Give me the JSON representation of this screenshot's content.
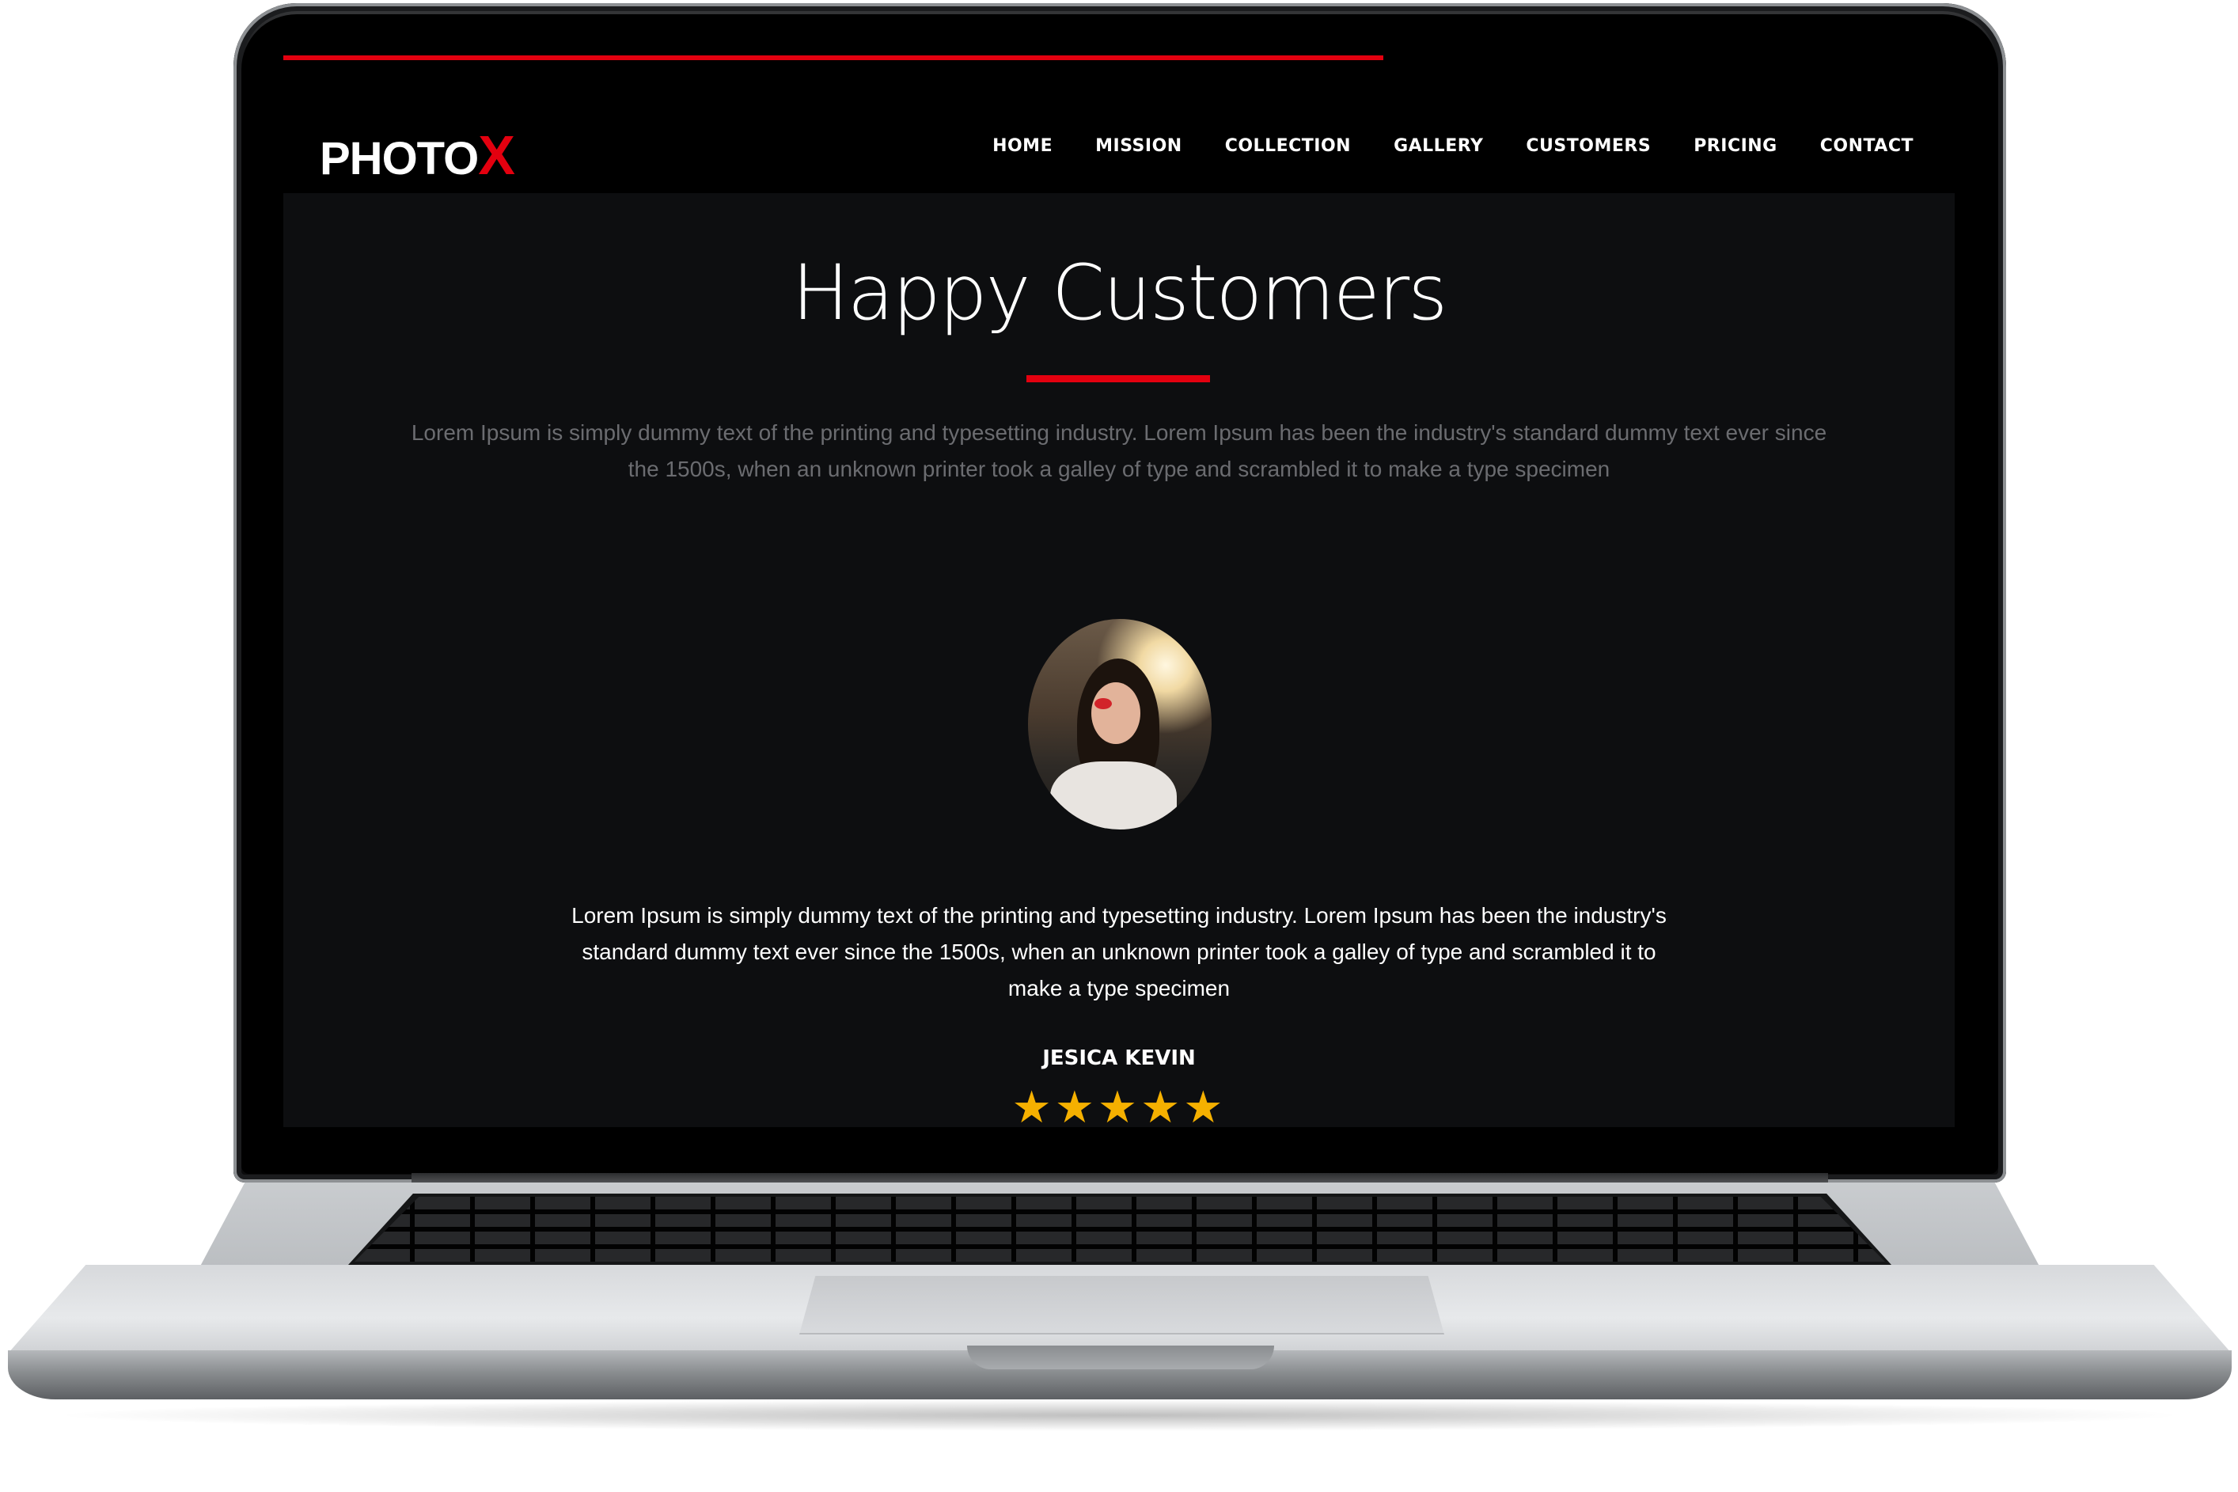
{
  "logo": {
    "text": "PHOTO",
    "accent": "X"
  },
  "nav": {
    "items": [
      "HOME",
      "MISSION",
      "COLLECTION",
      "GALLERY",
      "CUSTOMERS",
      "PRICING",
      "CONTACT"
    ]
  },
  "section": {
    "title": "Happy Customers",
    "intro": "Lorem Ipsum is simply dummy text of the printing and typesetting industry. Lorem Ipsum has been the industry's standard dummy text ever since the 1500s, when an unknown printer took a galley of type and scrambled it to make a type specimen"
  },
  "testimonial": {
    "quote": "Lorem Ipsum is simply dummy text of the printing and typesetting industry. Lorem Ipsum has been the industry's standard dummy text ever since the 1500s, when an unknown printer took a galley of type and scrambled it to make a type specimen",
    "name": "JESICA KEVIN",
    "rating": 5,
    "stars": "★★★★★",
    "avatar_icon": "customer-photo"
  },
  "carousel": {
    "slides": 3,
    "active_index": 0
  },
  "colors": {
    "accent": "#e3000f",
    "section_bg": "#0d0e10",
    "star": "#f5b000",
    "muted_text": "#6b6c70"
  }
}
